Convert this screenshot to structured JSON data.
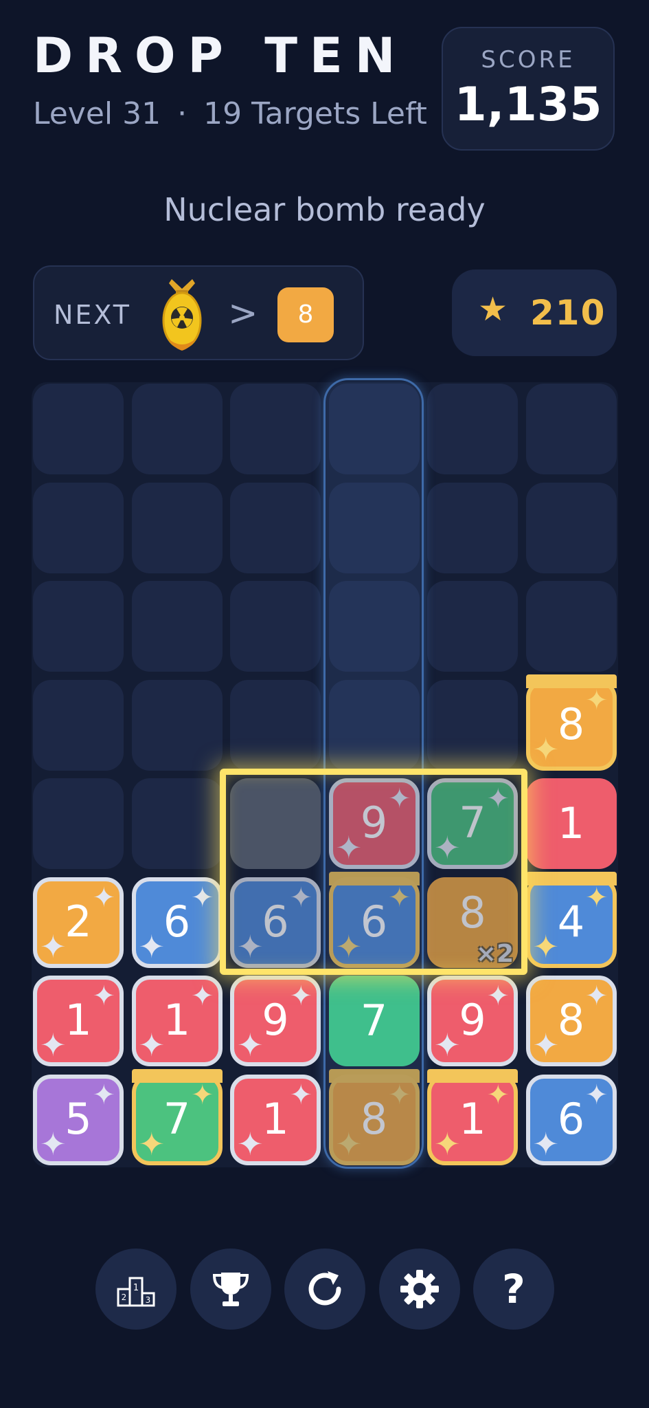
{
  "header": {
    "title": "DROP TEN",
    "level": "Level 31",
    "separator": "·",
    "targets": "19 Targets Left"
  },
  "score": {
    "label": "SCORE",
    "value": "1,135"
  },
  "status": "Nuclear bomb ready",
  "next": {
    "label": "NEXT",
    "bomb_icon": "nuclear-bomb-icon",
    "arrow": ">",
    "tile_value": "8",
    "tile_color": "#f2a943"
  },
  "stars": {
    "icon": "star-icon",
    "value": "210"
  },
  "board": {
    "columns": 6,
    "rows": 8,
    "highlighted_column": 4,
    "tiles": [
      {
        "id": "t-r4c6",
        "row": 4,
        "col": 6,
        "value": "8",
        "color": "orange",
        "gold": true
      },
      {
        "id": "t-r5c3",
        "row": 5,
        "col": 3,
        "value": "",
        "color": "empty-selected"
      },
      {
        "id": "t-r5c4",
        "row": 5,
        "col": 4,
        "value": "9",
        "color": "red",
        "faded": true
      },
      {
        "id": "t-r5c5",
        "row": 5,
        "col": 5,
        "value": "7",
        "color": "green",
        "faded": true
      },
      {
        "id": "t-r5c6",
        "row": 5,
        "col": 6,
        "value": "1",
        "color": "red",
        "plain": true
      },
      {
        "id": "t-r6c1",
        "row": 6,
        "col": 1,
        "value": "2",
        "color": "orange"
      },
      {
        "id": "t-r6c2",
        "row": 6,
        "col": 2,
        "value": "6",
        "color": "blue"
      },
      {
        "id": "t-r6c3",
        "row": 6,
        "col": 3,
        "value": "6",
        "color": "blue",
        "faded": true
      },
      {
        "id": "t-r6c4",
        "row": 6,
        "col": 4,
        "value": "6",
        "color": "blue",
        "faded": true,
        "gold": true
      },
      {
        "id": "t-r6c5",
        "row": 6,
        "col": 5,
        "value": "8",
        "color": "orange",
        "faded": true,
        "plain": true,
        "multiplier": "×2"
      },
      {
        "id": "t-r6c6",
        "row": 6,
        "col": 6,
        "value": "4",
        "color": "blue",
        "gold": true
      },
      {
        "id": "t-r7c1",
        "row": 7,
        "col": 1,
        "value": "1",
        "color": "red"
      },
      {
        "id": "t-r7c2",
        "row": 7,
        "col": 2,
        "value": "1",
        "color": "red"
      },
      {
        "id": "t-r7c3",
        "row": 7,
        "col": 3,
        "value": "9",
        "color": "red"
      },
      {
        "id": "t-r7c4",
        "row": 7,
        "col": 4,
        "value": "7",
        "color": "teal",
        "plain": true
      },
      {
        "id": "t-r7c5",
        "row": 7,
        "col": 5,
        "value": "9",
        "color": "red"
      },
      {
        "id": "t-r7c6",
        "row": 7,
        "col": 6,
        "value": "8",
        "color": "orange"
      },
      {
        "id": "t-r8c1",
        "row": 8,
        "col": 1,
        "value": "5",
        "color": "purple"
      },
      {
        "id": "t-r8c2",
        "row": 8,
        "col": 2,
        "value": "7",
        "color": "green",
        "gold": true
      },
      {
        "id": "t-r8c3",
        "row": 8,
        "col": 3,
        "value": "1",
        "color": "red"
      },
      {
        "id": "t-r8c4",
        "row": 8,
        "col": 4,
        "value": "8",
        "color": "orange",
        "gold": true,
        "faded": true
      },
      {
        "id": "t-r8c5",
        "row": 8,
        "col": 5,
        "value": "1",
        "color": "red",
        "gold": true
      },
      {
        "id": "t-r8c6",
        "row": 8,
        "col": 6,
        "value": "6",
        "color": "blue"
      }
    ]
  },
  "colors": {
    "orange": "#f2a943",
    "blue": "#4f8ad8",
    "red": "#ee5d6c",
    "green": "#4cc27f",
    "teal": "#3fbf8c",
    "purple": "#a776d8",
    "empty-selected": "#4b5466",
    "gold": "#f3c55a"
  },
  "toolbar": [
    {
      "id": "leaderboard",
      "icon": "podium-icon"
    },
    {
      "id": "achievements",
      "icon": "trophy-icon"
    },
    {
      "id": "restart",
      "icon": "restart-icon"
    },
    {
      "id": "settings",
      "icon": "gear-icon"
    },
    {
      "id": "help",
      "icon": "help-icon",
      "label": "?"
    }
  ]
}
